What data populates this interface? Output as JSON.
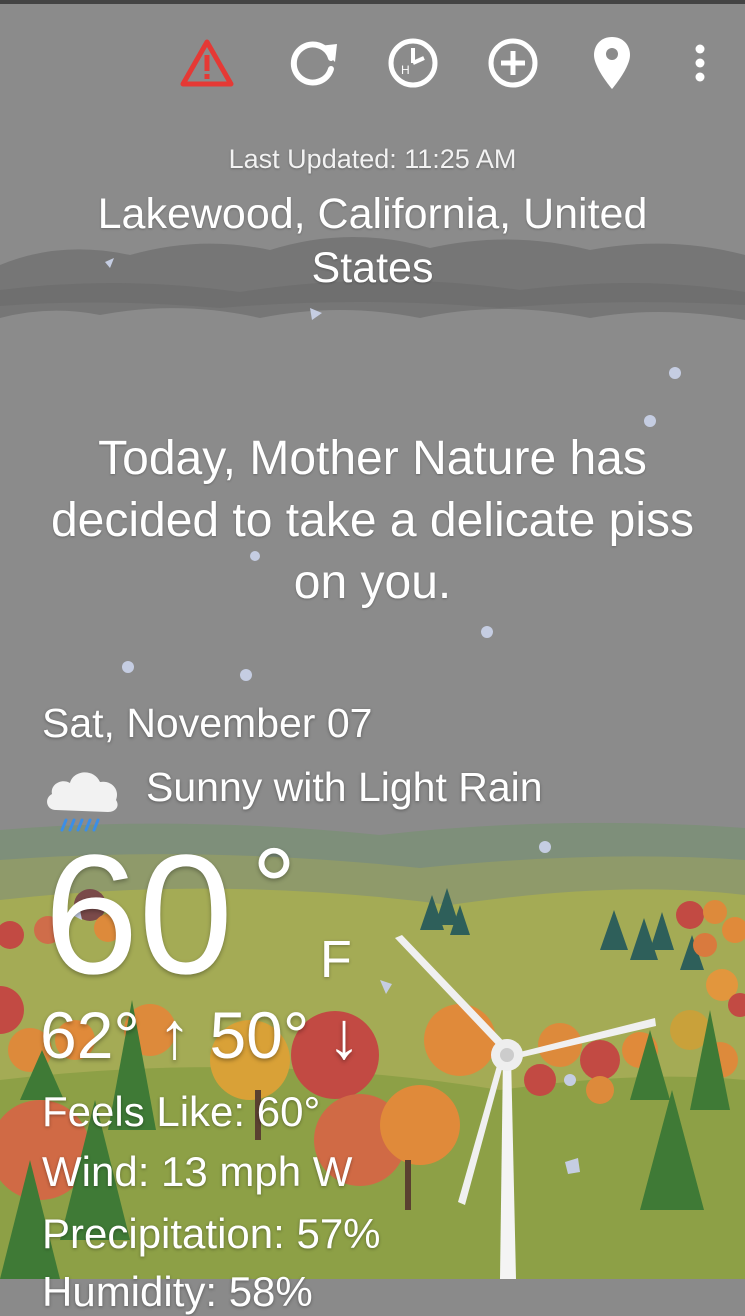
{
  "toolbar": {
    "icons": [
      "alert-icon",
      "refresh-icon",
      "history-clock-icon",
      "add-location-icon",
      "location-pin-icon",
      "more-vert-icon"
    ],
    "alert_color": "#e53935"
  },
  "header": {
    "last_updated": "Last Updated: 11:25 AM",
    "location": "Lakewood, California, United States"
  },
  "message": "Today, Mother Nature has decided to take a delicate piss on you.",
  "forecast": {
    "date": "Sat, November 07",
    "condition_icon": "cloud-rain-icon",
    "condition": "Sunny with Light Rain",
    "temperature": "60",
    "degree_symbol": "°",
    "unit": "F",
    "high_low": "62° ↑ 50° ↓",
    "feels_like": "Feels Like: 60°",
    "wind": "Wind: 13 mph W",
    "precipitation": "Precipitation: 57%",
    "humidity_partial": "Humidity: 58%"
  },
  "colors": {
    "sky": "#8a8a8a",
    "hills": "#9fa85a",
    "trees": [
      "#c24a43",
      "#dd8a3b",
      "#c9a13a",
      "#2f6a58",
      "#3f7a36"
    ]
  }
}
